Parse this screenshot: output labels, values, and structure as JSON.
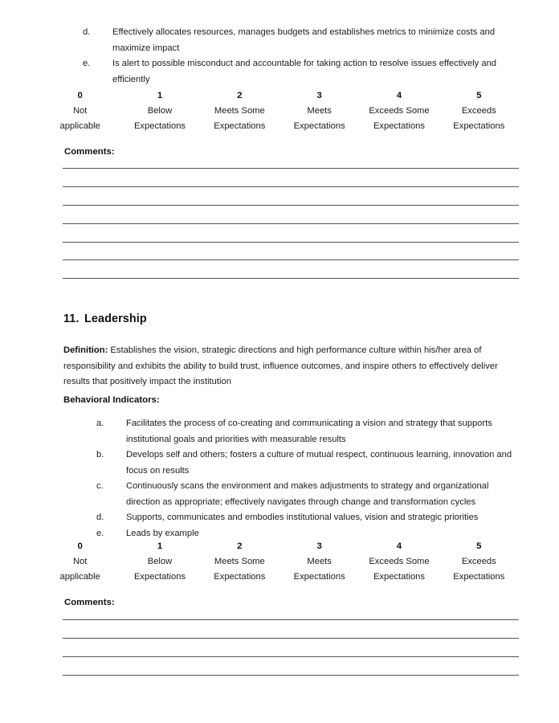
{
  "document": {
    "page_background": "#ffffff",
    "text_color": "#1c1c1c",
    "rule_color": "#545454"
  },
  "top_section": {
    "continued_indicators": [
      {
        "marker": "d.",
        "text": "Effectively allocates resources, manages budgets and establishes metrics to minimize costs and maximize impact"
      },
      {
        "marker": "e.",
        "text": "Is alert to possible misconduct and accountable for taking action to resolve issues effectively and efficiently"
      }
    ],
    "comments_label": "Comments:",
    "comment_line_count": 7
  },
  "rating_scale": {
    "columns": [
      {
        "number": "0",
        "line1": "Not",
        "line2": "applicable"
      },
      {
        "number": "1",
        "line1": "Below",
        "line2": "Expectations"
      },
      {
        "number": "2",
        "line1": "Meets Some",
        "line2": "Expectations"
      },
      {
        "number": "3",
        "line1": "Meets",
        "line2": "Expectations"
      },
      {
        "number": "4",
        "line1": "Exceeds Some",
        "line2": "Expectations"
      },
      {
        "number": "5",
        "line1": "Exceeds",
        "line2": "Expectations"
      }
    ]
  },
  "leadership_section": {
    "number": "11.",
    "title": "Leadership",
    "definition_label": "Definition:",
    "definition_text": "Establishes the vision, strategic directions and high performance culture within his/her area of responsibility and exhibits the ability to build trust, influence outcomes, and inspire others to effectively deliver results that positively impact the institution",
    "indicators_label": "Behavioral Indicators:",
    "indicators": [
      {
        "marker": "a.",
        "text": "Facilitates the process of co-creating and communicating a vision and strategy that supports institutional goals and priorities with measurable results"
      },
      {
        "marker": "b.",
        "text": "Develops self and others; fosters a culture of mutual respect, continuous learning, innovation and focus on results"
      },
      {
        "marker": "c.",
        "text": "Continuously scans the environment and makes adjustments to strategy and organizational direction as appropriate; effectively navigates through change and transformation cycles"
      },
      {
        "marker": "d.",
        "text": "Supports, communicates and embodies  institutional values, vision and strategic priorities"
      },
      {
        "marker": "e.",
        "text": "Leads by example"
      }
    ],
    "comments_label": "Comments:",
    "comment_line_count": 4
  }
}
